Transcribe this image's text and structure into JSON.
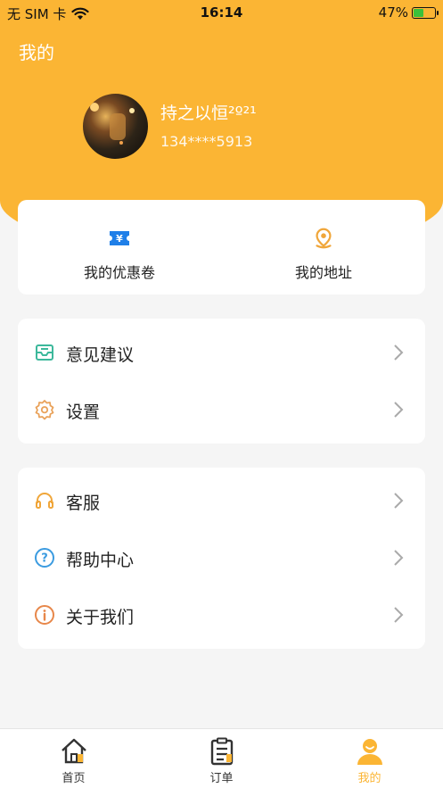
{
  "status_bar": {
    "carrier": "无 SIM 卡",
    "time": "16:14",
    "battery": "47%",
    "battery_level": 0.47
  },
  "header": {
    "title": "我的"
  },
  "profile": {
    "name": "持之以恒²º²¹",
    "phone": "134****5913"
  },
  "quick_actions": [
    {
      "label": "我的优惠卷",
      "icon": "coupon-icon"
    },
    {
      "label": "我的地址",
      "icon": "location-pin-icon"
    }
  ],
  "menu_group_1": [
    {
      "label": "意见建议",
      "icon": "feedback-inbox-icon"
    },
    {
      "label": "设置",
      "icon": "gear-icon"
    }
  ],
  "menu_group_2": [
    {
      "label": "客服",
      "icon": "headset-icon"
    },
    {
      "label": "帮助中心",
      "icon": "help-icon"
    },
    {
      "label": "关于我们",
      "icon": "info-icon"
    }
  ],
  "tabs": [
    {
      "label": "首页",
      "icon": "home-icon"
    },
    {
      "label": "订单",
      "icon": "order-clipboard-icon"
    },
    {
      "label": "我的",
      "icon": "profile-icon",
      "active": true
    }
  ],
  "colors": {
    "accent": "#fbb534",
    "coupon": "#1f7fe8",
    "feedback": "#3cb89b",
    "gear": "#e9a25a",
    "headset": "#f0a63a",
    "help": "#3b9be0",
    "info": "#e7874a"
  }
}
